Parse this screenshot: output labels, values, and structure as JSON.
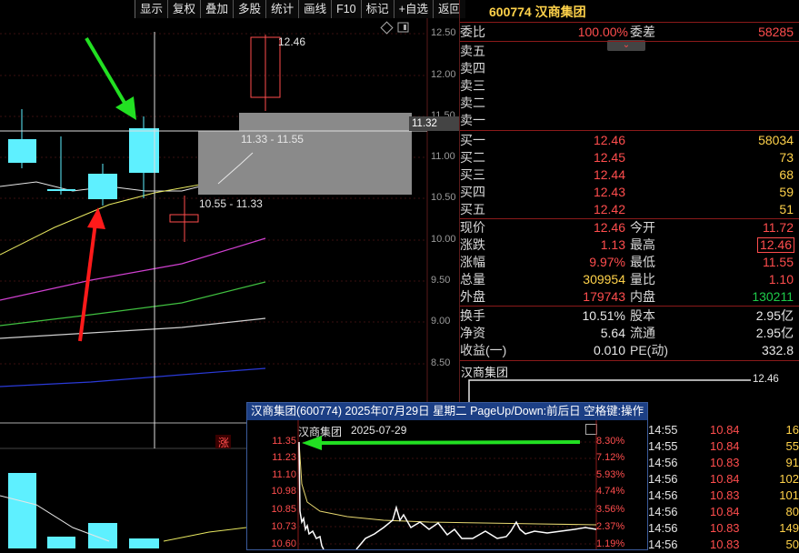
{
  "toolbar": [
    "显示",
    "复权",
    "叠加",
    "多股",
    "统计",
    "画线",
    "F10",
    "标记",
    "+自选",
    "返回"
  ],
  "stock": {
    "code": "600774",
    "name": "汉商集团",
    "title": "600774 汉商集团"
  },
  "price_axis": [
    "12.50",
    "12.00",
    "11.50",
    "11.00",
    "10.50",
    "10.00",
    "9.50",
    "9.00",
    "8.50"
  ],
  "crosshair_price": "11.32",
  "annotations": {
    "high": "12.46",
    "zone_upper": "11.33 - 11.55",
    "zone_lower": "10.55 - 11.33",
    "limit_up_mark": "涨"
  },
  "order_book": {
    "ratio_label": "委比",
    "ratio_value": "100.00%",
    "diff_label": "委差",
    "diff_value": "58285",
    "asks": [
      {
        "label": "卖五"
      },
      {
        "label": "卖四"
      },
      {
        "label": "卖三"
      },
      {
        "label": "卖二"
      },
      {
        "label": "卖一"
      }
    ],
    "bids": [
      {
        "label": "买一",
        "price": "12.46",
        "vol": "58034"
      },
      {
        "label": "买二",
        "price": "12.45",
        "vol": "73"
      },
      {
        "label": "买三",
        "price": "12.44",
        "vol": "68"
      },
      {
        "label": "买四",
        "price": "12.43",
        "vol": "59"
      },
      {
        "label": "买五",
        "price": "12.42",
        "vol": "51"
      }
    ]
  },
  "quote": [
    {
      "l1": "现价",
      "v1": "12.46",
      "l2": "今开",
      "v2": "11.72"
    },
    {
      "l1": "涨跌",
      "v1": "1.13",
      "l2": "最高",
      "v2": "12.46"
    },
    {
      "l1": "涨幅",
      "v1": "9.97%",
      "l2": "最低",
      "v2": "11.55"
    },
    {
      "l1": "总量",
      "v1": "309954",
      "l2": "量比",
      "v2": "1.10"
    },
    {
      "l1": "外盘",
      "v1": "179743",
      "l2": "内盘",
      "v2": "130211"
    }
  ],
  "fundamentals": [
    {
      "l1": "换手",
      "v1": "10.51%",
      "l2": "股本",
      "v2": "2.95亿"
    },
    {
      "l1": "净资",
      "v1": "5.64",
      "l2": "流通",
      "v2": "2.95亿"
    },
    {
      "l1": "收益(一)",
      "v1": "0.010",
      "l2": "PE(动)",
      "v2": "332.8"
    }
  ],
  "mini_chart": {
    "name": "汉商集团",
    "price": "12.46"
  },
  "popup": {
    "title": "汉商集团(600774) 2025年07月29日 星期二 PageUp/Down:前后日 空格键:操作",
    "sub_name": "汉商集团",
    "sub_date": "2025-07-29",
    "left_ticks": [
      "11.35",
      "11.23",
      "11.10",
      "10.98",
      "10.85",
      "10.73",
      "10.60"
    ],
    "right_ticks": [
      "8.30%",
      "7.12%",
      "5.93%",
      "4.74%",
      "3.56%",
      "2.37%",
      "1.19%"
    ]
  },
  "trades": [
    {
      "time": "14:55",
      "price": "10.84",
      "vol": "16"
    },
    {
      "time": "14:55",
      "price": "10.84",
      "vol": "55"
    },
    {
      "time": "14:56",
      "price": "10.83",
      "vol": "91"
    },
    {
      "time": "14:56",
      "price": "10.84",
      "vol": "102"
    },
    {
      "time": "14:56",
      "price": "10.83",
      "vol": "101"
    },
    {
      "time": "14:56",
      "price": "10.84",
      "vol": "80"
    },
    {
      "time": "14:56",
      "price": "10.83",
      "vol": "149"
    },
    {
      "time": "14:56",
      "price": "10.83",
      "vol": "50"
    }
  ],
  "colors": {
    "up": "#ff4d4d",
    "down": "#00e0ff",
    "bg": "#000000",
    "accent": "#ffd24a"
  }
}
